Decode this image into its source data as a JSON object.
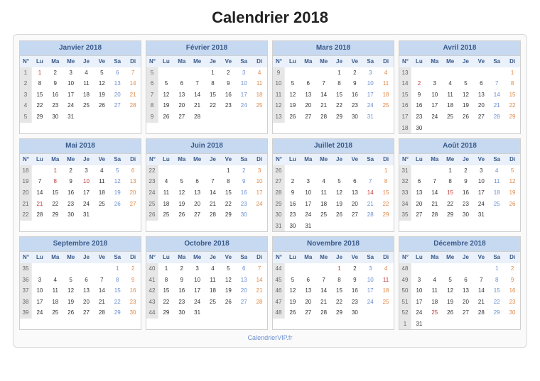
{
  "title": "Calendrier 2018",
  "footer": "CalendrierVIP.fr",
  "weeknum_header": "N°",
  "dow": [
    "Lu",
    "Ma",
    "Me",
    "Je",
    "Ve",
    "Sa",
    "Di"
  ],
  "months": [
    {
      "name": "Janvier 2018",
      "weeks": [
        {
          "n": 1,
          "d": [
            1,
            2,
            3,
            4,
            5,
            6,
            7
          ],
          "hol": [
            1
          ]
        },
        {
          "n": 2,
          "d": [
            8,
            9,
            10,
            11,
            12,
            13,
            14
          ]
        },
        {
          "n": 3,
          "d": [
            15,
            16,
            17,
            18,
            19,
            20,
            21
          ]
        },
        {
          "n": 4,
          "d": [
            22,
            23,
            24,
            25,
            26,
            27,
            28
          ]
        },
        {
          "n": 5,
          "d": [
            29,
            30,
            31,
            null,
            null,
            null,
            null
          ]
        }
      ]
    },
    {
      "name": "Février 2018",
      "weeks": [
        {
          "n": 5,
          "d": [
            null,
            null,
            null,
            1,
            2,
            3,
            4
          ]
        },
        {
          "n": 6,
          "d": [
            5,
            6,
            7,
            8,
            9,
            10,
            11
          ]
        },
        {
          "n": 7,
          "d": [
            12,
            13,
            14,
            15,
            16,
            17,
            18
          ]
        },
        {
          "n": 8,
          "d": [
            19,
            20,
            21,
            22,
            23,
            24,
            25
          ]
        },
        {
          "n": 9,
          "d": [
            26,
            27,
            28,
            null,
            null,
            null,
            null
          ]
        }
      ]
    },
    {
      "name": "Mars 2018",
      "weeks": [
        {
          "n": 9,
          "d": [
            null,
            null,
            null,
            1,
            2,
            3,
            4
          ]
        },
        {
          "n": 10,
          "d": [
            5,
            6,
            7,
            8,
            9,
            10,
            11
          ]
        },
        {
          "n": 11,
          "d": [
            12,
            13,
            14,
            15,
            16,
            17,
            18
          ]
        },
        {
          "n": 12,
          "d": [
            19,
            20,
            21,
            22,
            23,
            24,
            25
          ]
        },
        {
          "n": 13,
          "d": [
            26,
            27,
            28,
            29,
            30,
            31,
            null
          ]
        }
      ]
    },
    {
      "name": "Avril 2018",
      "weeks": [
        {
          "n": 13,
          "d": [
            null,
            null,
            null,
            null,
            null,
            null,
            1
          ]
        },
        {
          "n": 14,
          "d": [
            2,
            3,
            4,
            5,
            6,
            7,
            8
          ],
          "hol": [
            2
          ]
        },
        {
          "n": 15,
          "d": [
            9,
            10,
            11,
            12,
            13,
            14,
            15
          ]
        },
        {
          "n": 16,
          "d": [
            16,
            17,
            18,
            19,
            20,
            21,
            22
          ]
        },
        {
          "n": 17,
          "d": [
            23,
            24,
            25,
            26,
            27,
            28,
            29
          ]
        },
        {
          "n": 18,
          "d": [
            30,
            null,
            null,
            null,
            null,
            null,
            null
          ]
        }
      ]
    },
    {
      "name": "Mai 2018",
      "weeks": [
        {
          "n": 18,
          "d": [
            null,
            1,
            2,
            3,
            4,
            5,
            6
          ],
          "hol": [
            1
          ]
        },
        {
          "n": 19,
          "d": [
            7,
            8,
            9,
            10,
            11,
            12,
            13
          ],
          "hol": [
            8,
            10
          ]
        },
        {
          "n": 20,
          "d": [
            14,
            15,
            16,
            17,
            18,
            19,
            20
          ]
        },
        {
          "n": 21,
          "d": [
            21,
            22,
            23,
            24,
            25,
            26,
            27
          ],
          "hol": [
            21
          ]
        },
        {
          "n": 22,
          "d": [
            28,
            29,
            30,
            31,
            null,
            null,
            null
          ]
        }
      ]
    },
    {
      "name": "Juin 2018",
      "weeks": [
        {
          "n": 22,
          "d": [
            null,
            null,
            null,
            null,
            1,
            2,
            3
          ]
        },
        {
          "n": 23,
          "d": [
            4,
            5,
            6,
            7,
            8,
            9,
            10
          ]
        },
        {
          "n": 24,
          "d": [
            11,
            12,
            13,
            14,
            15,
            16,
            17
          ]
        },
        {
          "n": 25,
          "d": [
            18,
            19,
            20,
            21,
            22,
            23,
            24
          ]
        },
        {
          "n": 26,
          "d": [
            25,
            26,
            27,
            28,
            29,
            30,
            null
          ]
        }
      ]
    },
    {
      "name": "Juillet 2018",
      "weeks": [
        {
          "n": 26,
          "d": [
            null,
            null,
            null,
            null,
            null,
            null,
            1
          ]
        },
        {
          "n": 27,
          "d": [
            2,
            3,
            4,
            5,
            6,
            7,
            8
          ]
        },
        {
          "n": 28,
          "d": [
            9,
            10,
            11,
            12,
            13,
            14,
            15
          ],
          "hol": [
            14
          ]
        },
        {
          "n": 29,
          "d": [
            16,
            17,
            18,
            19,
            20,
            21,
            22
          ]
        },
        {
          "n": 30,
          "d": [
            23,
            24,
            25,
            26,
            27,
            28,
            29
          ]
        },
        {
          "n": 31,
          "d": [
            30,
            31,
            null,
            null,
            null,
            null,
            null
          ]
        }
      ]
    },
    {
      "name": "Août 2018",
      "weeks": [
        {
          "n": 31,
          "d": [
            null,
            null,
            1,
            2,
            3,
            4,
            5
          ]
        },
        {
          "n": 32,
          "d": [
            6,
            7,
            8,
            9,
            10,
            11,
            12
          ]
        },
        {
          "n": 33,
          "d": [
            13,
            14,
            15,
            16,
            17,
            18,
            19
          ],
          "hol": [
            15
          ]
        },
        {
          "n": 34,
          "d": [
            20,
            21,
            22,
            23,
            24,
            25,
            26
          ]
        },
        {
          "n": 35,
          "d": [
            27,
            28,
            29,
            30,
            31,
            null,
            null
          ]
        }
      ]
    },
    {
      "name": "Septembre 2018",
      "weeks": [
        {
          "n": 35,
          "d": [
            null,
            null,
            null,
            null,
            null,
            1,
            2
          ]
        },
        {
          "n": 36,
          "d": [
            3,
            4,
            5,
            6,
            7,
            8,
            9
          ]
        },
        {
          "n": 37,
          "d": [
            10,
            11,
            12,
            13,
            14,
            15,
            16
          ]
        },
        {
          "n": 38,
          "d": [
            17,
            18,
            19,
            20,
            21,
            22,
            23
          ]
        },
        {
          "n": 39,
          "d": [
            24,
            25,
            26,
            27,
            28,
            29,
            30
          ]
        }
      ]
    },
    {
      "name": "Octobre 2018",
      "weeks": [
        {
          "n": 40,
          "d": [
            1,
            2,
            3,
            4,
            5,
            6,
            7
          ]
        },
        {
          "n": 41,
          "d": [
            8,
            9,
            10,
            11,
            12,
            13,
            14
          ]
        },
        {
          "n": 42,
          "d": [
            15,
            16,
            17,
            18,
            19,
            20,
            21
          ]
        },
        {
          "n": 43,
          "d": [
            22,
            23,
            24,
            25,
            26,
            27,
            28
          ]
        },
        {
          "n": 44,
          "d": [
            29,
            30,
            31,
            null,
            null,
            null,
            null
          ]
        }
      ]
    },
    {
      "name": "Novembre 2018",
      "weeks": [
        {
          "n": 44,
          "d": [
            null,
            null,
            null,
            1,
            2,
            3,
            4
          ],
          "hol": [
            1
          ]
        },
        {
          "n": 45,
          "d": [
            5,
            6,
            7,
            8,
            9,
            10,
            11
          ],
          "hol": [
            11
          ]
        },
        {
          "n": 46,
          "d": [
            12,
            13,
            14,
            15,
            16,
            17,
            18
          ]
        },
        {
          "n": 47,
          "d": [
            19,
            20,
            21,
            22,
            23,
            24,
            25
          ]
        },
        {
          "n": 48,
          "d": [
            26,
            27,
            28,
            29,
            30,
            null,
            null
          ]
        }
      ]
    },
    {
      "name": "Décembre 2018",
      "weeks": [
        {
          "n": 48,
          "d": [
            null,
            null,
            null,
            null,
            null,
            1,
            2
          ]
        },
        {
          "n": 49,
          "d": [
            3,
            4,
            5,
            6,
            7,
            8,
            9
          ]
        },
        {
          "n": 50,
          "d": [
            10,
            11,
            12,
            13,
            14,
            15,
            16
          ]
        },
        {
          "n": 51,
          "d": [
            17,
            18,
            19,
            20,
            21,
            22,
            23
          ]
        },
        {
          "n": 52,
          "d": [
            24,
            25,
            26,
            27,
            28,
            29,
            30
          ],
          "hol": [
            25
          ]
        },
        {
          "n": 1,
          "d": [
            31,
            null,
            null,
            null,
            null,
            null,
            null
          ]
        }
      ]
    }
  ]
}
